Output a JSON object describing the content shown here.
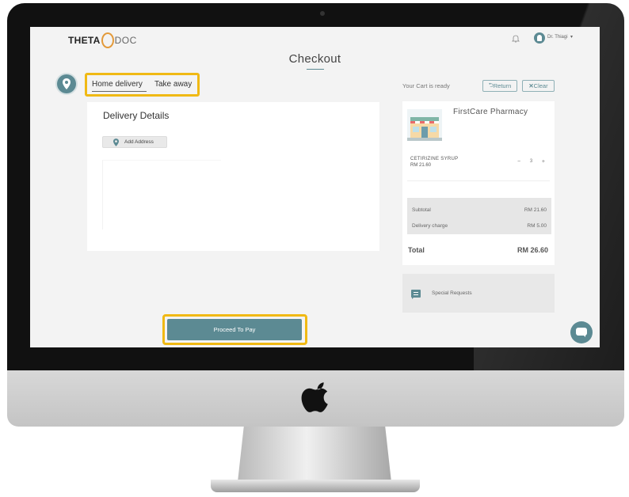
{
  "app": {
    "logo_left": "THETA",
    "logo_right": "DOC",
    "user_name": "Dr. Thiagi",
    "user_caret": "▾"
  },
  "page": {
    "title": "Checkout"
  },
  "delivery_tabs": [
    {
      "label": "Home delivery",
      "active": true
    },
    {
      "label": "Take away",
      "active": false
    }
  ],
  "delivery_details": {
    "heading": "Delivery Details",
    "add_address_label": "Add Address"
  },
  "cart": {
    "status": "Your Cart is ready",
    "return_label": "Return",
    "clear_label": "Clear",
    "pharmacy_name": "FirstCare Pharmacy",
    "items": [
      {
        "name": "CETIRIZINE SYRUP",
        "price": "RM 21.60",
        "quantity": "3",
        "minus": "−",
        "plus": "+"
      }
    ],
    "subtotal_label": "Subtotal",
    "subtotal_value": "RM 21.60",
    "delivery_label": "Delivery charge",
    "delivery_value": "RM 5.00",
    "total_label": "Total",
    "total_value": "RM 26.60"
  },
  "special_requests": {
    "label": "Special Requests"
  },
  "pay": {
    "label": "Proceed To Pay"
  },
  "colors": {
    "accent": "#5c8a93",
    "highlight": "#f0b914",
    "background": "#f3f3f3"
  },
  "icons": [
    "bell-icon",
    "user-avatar-icon",
    "location-pin-icon",
    "map-pin-icon",
    "return-icon",
    "close-icon",
    "store-icon",
    "message-icon",
    "chat-icon",
    "apple-logo-icon"
  ]
}
